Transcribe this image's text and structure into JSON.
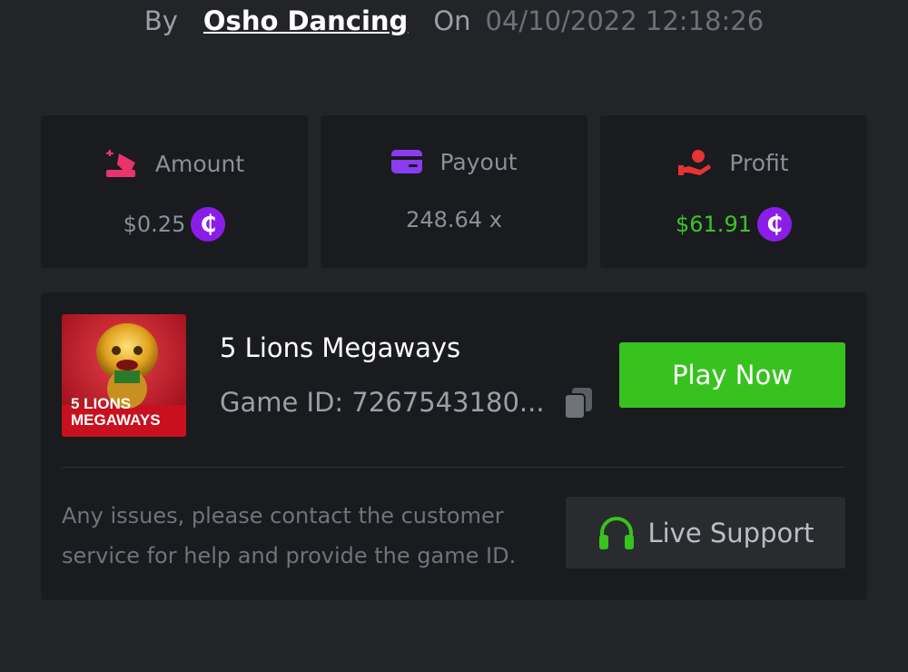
{
  "bet_info": {
    "by_label": "By",
    "username": "Osho Dancing",
    "on_label": "On",
    "datetime": "04/10/2022 12:18:26"
  },
  "stats": {
    "amount": {
      "label": "Amount",
      "value": "$0.25",
      "icon": "amount-icon",
      "color": "#e8336d"
    },
    "payout": {
      "label": "Payout",
      "value": "248.64 x",
      "icon": "card-icon",
      "color": "#8a3cf0"
    },
    "profit": {
      "label": "Profit",
      "value": "$61.91",
      "icon": "hand-money-icon",
      "color": "#e83333",
      "value_color": "#3cc42a"
    }
  },
  "coin_symbol": "₵",
  "game": {
    "title": "5 Lions Megaways",
    "id_label": "Game ID: 7267543180...",
    "thumb_line1": "5 LIONS",
    "thumb_line2": "MEGAWAYS",
    "play_label": "Play Now"
  },
  "support": {
    "help_text": "Any issues, please contact the customer service for help and provide the game ID.",
    "button_label": "Live Support"
  },
  "colors": {
    "background": "#232428",
    "card": "#1a1b1e",
    "accent_green": "#38c21f",
    "coin_purple": "#8a1ee8"
  }
}
